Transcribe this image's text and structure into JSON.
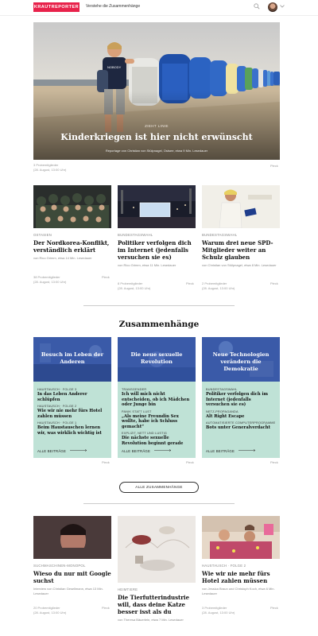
{
  "header": {
    "logo": "KRAUTREPORTER",
    "tagline": "Verstehe die Zusammenhänge"
  },
  "hero": {
    "kicker": "ZIEHT LINIE",
    "title": "Kinderkriegen ist hier nicht erwünscht",
    "byline": "Reportage von Christian von Stülpnagel, Ostsee, etwa 9 Min. Lesedauer",
    "shirt_text": "NOBODY",
    "meta": "3 Probemitglieder",
    "date": "(28. August, 13:00 Uhr)",
    "right": "Pieck"
  },
  "articles": [
    {
      "kicker": "OSTASIEN",
      "title": "Der Nordkorea-Konflikt, verständlich erklärt",
      "byline": "von Rico Grimm, etwa 14 Min. Lesedauer",
      "meta": "38 Probemitglieder",
      "date": "(28. August, 13:00 Uhr)",
      "right": "Pieck"
    },
    {
      "kicker": "BUNDESTAGSWAHL",
      "title": "Politiker verfolgen dich im Internet (jedenfalls versuchen sie es)",
      "byline": "von Rico Grimm, etwa 11 Min. Lesedauer",
      "meta": "8 Probemitglieder",
      "date": "(28. August, 13:00 Uhr)",
      "right": "Pieck"
    },
    {
      "kicker": "BUNDESTAGSWAHL",
      "title": "Warum drei neue SPD-Mitglieder weiter an Schulz glauben",
      "byline": "von Christian von Stülpnagel, etwa 8 Min. Lesedauer",
      "meta": "2 Probemitglieder",
      "date": "(28. August, 13:00 Uhr)",
      "right": "Pieck"
    }
  ],
  "section_title": "Zusammenhänge",
  "themes": [
    {
      "title": "Besuch im Leben der Anderen",
      "items": [
        {
          "kicker": "HAUSTAUSCH · FOLGE 3",
          "title": "In das Leben Anderer schlüpfen"
        },
        {
          "kicker": "HAUSTAUSCH · FOLGE 2",
          "title": "Wie wir nie mehr fürs Hotel zahlen müssen"
        },
        {
          "kicker": "HAUSTAUSCH · FOLGE 1",
          "title": "Beim Haustauschen lernen wir, was wirklich wichtig ist"
        }
      ],
      "all": "ALLE BEITRÄGE",
      "right": "Pieck"
    },
    {
      "title": "Die neue sexuelle Revolution",
      "items": [
        {
          "kicker": "TRANSGENDER",
          "title": "Ich will mich nicht entscheiden, ob ich Mädchen oder Junge bin"
        },
        {
          "kicker": "PANIK STATT LUST",
          "title": "„Als meine Freundin Sex wollte, habe ich Schluss gemacht“"
        },
        {
          "kicker": "EXPLIZIT, NETT UND LUSTIG",
          "title": "Die nächste sexuelle Revolution beginnt gerade"
        }
      ],
      "all": "ALLE BEITRÄGE",
      "right": "Pieck"
    },
    {
      "title": "Neue Technologien verändern die Demokratie",
      "items": [
        {
          "kicker": "BUNDESTAGSWAHL",
          "title": "Politiker verfolgen dich im Internet (jedenfalls versuchen sie es)"
        },
        {
          "kicker": "NETZ-PROPAGANDA",
          "title": "Alt Right Escape"
        },
        {
          "kicker": "AUTOMATISIERTE COMPUTERPROGRAMME",
          "title": "Bots unter Generalverdacht"
        }
      ],
      "all": "ALLE BEITRÄGE",
      "right": "Pieck"
    }
  ],
  "all_themes_button": "ALLE ZUSAMMENHÄNGE",
  "bottom_articles": [
    {
      "kicker": "SUCHMASCHINEN-MONOPOL",
      "title": "Wieso du nur mit Google suchst",
      "byline": "Interview von Christian Gesellmann, etwa 13 Min. Lesedauer",
      "meta": "20 Probemitglieder",
      "date": "(28. August, 13:00 Uhr)",
      "right": "Pieck"
    },
    {
      "kicker": "HEIMTIERE",
      "title": "Die Tierfutterindustrie will, dass deine Katze besser isst als du",
      "byline": "von Theresa Bäuerlein, etwa 7 Min. Lesedauer"
    },
    {
      "kicker": "HAUSTAUSCH · FOLGE 2",
      "title": "Wie wir nie mehr fürs Hotel zahlen müssen",
      "byline": "von Jessica Braun und Christoph Koch, etwa 6 Min. Lesedauer",
      "meta": "3 Probemitglieder",
      "date": "(28. August, 13:00 Uhr)",
      "right": "Pieck"
    }
  ],
  "colors": {
    "brand": "#e8224b",
    "theme_bg": "#bfe2d6",
    "theme_header": "#3a5aa8"
  }
}
